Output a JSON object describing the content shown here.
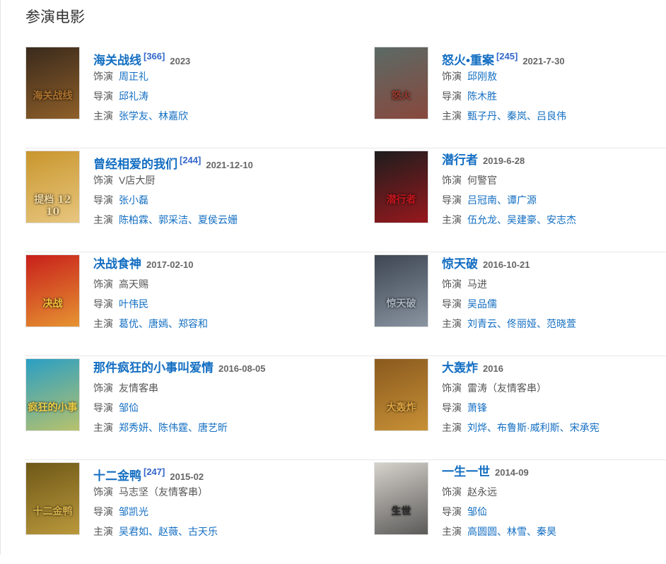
{
  "section": {
    "title": "参演电影"
  },
  "labels": {
    "role": "饰演",
    "director": "导演",
    "cast": "主演"
  },
  "films": [
    {
      "title": "海关战线",
      "ref": "[366]",
      "date": "2023",
      "role": "周正礼",
      "role_linked": true,
      "director": "邱礼涛",
      "cast": "张学友、林嘉欣",
      "poster": {
        "text": "海关战线",
        "bg": "#3a2a1c",
        "accent": "#b0742e"
      }
    },
    {
      "title": "怒火•重案",
      "ref": "[245]",
      "date": "2021-7-30",
      "role": "邱刚敖",
      "role_linked": true,
      "director": "陈木胜",
      "cast": "甄子丹、秦岚、吕良伟",
      "poster": {
        "text": "怒火",
        "bg": "#5b6a66",
        "accent": "#9a3a2c"
      }
    },
    {
      "title": "曾经相爱的我们",
      "ref": "[244]",
      "date": "2021-12-10",
      "role": "V店大厨",
      "role_linked": false,
      "director": "张小磊",
      "cast": "陈柏霖、郭采洁、夏侯云姗",
      "poster": {
        "text": "提档 12 10",
        "bg": "#c9962d",
        "accent": "#f3d9a0"
      }
    },
    {
      "title": "潜行者",
      "ref": "",
      "date": "2019-6-28",
      "role": "何警官",
      "role_linked": false,
      "director": "吕冠南、谭广源",
      "cast": "伍允龙、吴建豪、安志杰",
      "poster": {
        "text": "潜行者",
        "bg": "#1d1d1d",
        "accent": "#c8161d"
      }
    },
    {
      "title": "决战食神",
      "ref": "",
      "date": "2017-02-10",
      "role": "高天赐",
      "role_linked": false,
      "director": "叶伟民",
      "cast": "葛优、唐嫣、郑容和",
      "poster": {
        "text": "决战",
        "bg": "#c81f1b",
        "accent": "#f2c33b"
      }
    },
    {
      "title": "惊天破",
      "ref": "",
      "date": "2016-10-21",
      "role": "马进",
      "role_linked": false,
      "director": "吴品儒",
      "cast": "刘青云、佟丽娅、范晓萱",
      "poster": {
        "text": "惊天破",
        "bg": "#3d4652",
        "accent": "#a8b4c0"
      }
    },
    {
      "title": "那件疯狂的小事叫爱情",
      "ref": "",
      "date": "2016-08-05",
      "role": "友情客串",
      "role_linked": false,
      "director": "邹佡",
      "cast": "郑秀妍、陈伟霆、唐艺昕",
      "poster": {
        "text": "疯狂的小事",
        "bg": "#2a9fc4",
        "accent": "#f0d048"
      }
    },
    {
      "title": "大轰炸",
      "ref": "",
      "date": "2016",
      "role": "雷涛（友情客串）",
      "role_linked": false,
      "director": "萧锋",
      "cast": "刘烨、布鲁斯·威利斯、宋承宪",
      "poster": {
        "text": "大轰炸",
        "bg": "#8a5a1e",
        "accent": "#e0a640"
      }
    },
    {
      "title": "十二金鸭",
      "ref": "[247]",
      "date": "2015-02",
      "role": "马志坚（友情客串）",
      "role_linked": false,
      "director": "邹凯光",
      "cast": "吴君如、赵薇、古天乐",
      "poster": {
        "text": "十二金鸭",
        "bg": "#6e5818",
        "accent": "#d9b24a"
      }
    },
    {
      "title": "一生一世",
      "ref": "",
      "date": "2014-09",
      "role": "赵永远",
      "role_linked": false,
      "director": "邹佡",
      "cast": "高圆圆、林雪、秦昊",
      "poster": {
        "text": "生世",
        "bg": "#d6d2cc",
        "accent": "#2a2a2a"
      }
    }
  ]
}
